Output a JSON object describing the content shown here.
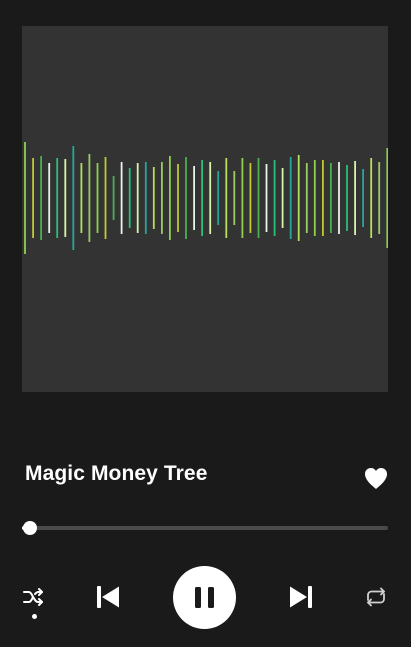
{
  "track": {
    "title": "Magic Money Tree",
    "liked": true
  },
  "playback": {
    "progress": 0.02,
    "is_playing": true,
    "shuffle_active": true
  },
  "icons": {
    "like": "heart-icon",
    "shuffle": "shuffle-icon",
    "previous": "skip-previous-icon",
    "pause": "pause-icon",
    "next": "skip-next-icon",
    "repeat": "repeat-icon"
  },
  "colors": {
    "background": "#1a1a1a",
    "artwork_background": "#333333",
    "track": "#4a4a4a",
    "foreground": "#ffffff",
    "waveform_palette": [
      "#d6f5a8",
      "#b5e05c",
      "#8fd14f",
      "#4caf50",
      "#2bbf7a",
      "#26a69a",
      "#9ccc65",
      "#c0ca33",
      "#e8f5e9"
    ]
  }
}
